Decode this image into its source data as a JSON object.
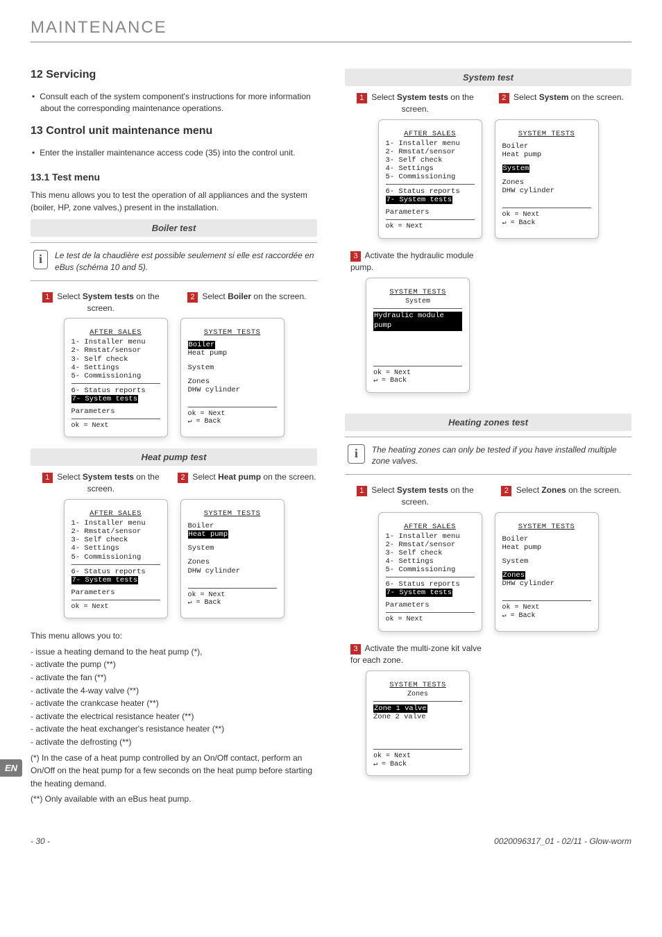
{
  "header": {
    "title": "MAINTENANCE"
  },
  "s12": {
    "heading": "12   Servicing",
    "bullet": "Consult each of the system component's instructions for more information about the corresponding maintenance operations."
  },
  "s13": {
    "heading": "13   Control unit maintenance menu",
    "bullet": "Enter the installer maintenance access code (35) into the control unit.",
    "sub": "13.1    Test menu",
    "intro": "This menu allows you to test the operation of all appliances and the system (boiler, HP, zone valves,) present in the installation."
  },
  "boiler": {
    "title": "Boiler test",
    "info": "Le test de la chaudière est possible seulement si elle est raccordée en eBus (schéma 10 and 5).",
    "step1": "Select System tests on the screen.",
    "step2": "Select Boiler on the screen."
  },
  "heatpump": {
    "title": "Heat pump test",
    "step1": "Select System tests on the screen.",
    "step2": "Select Heat pump on the screen.",
    "intro": "This menu allows you to:",
    "items": [
      "- issue a heating demand to the heat pump (*),",
      "- activate the pump (**)",
      "- activate the fan (**)",
      "- activate the 4-way valve (**)",
      "- activate the crankcase heater (**)",
      "- activate the electrical resistance heater (**)",
      "- activate the heat exchanger's resistance heater (**)",
      "- activate the defrosting (**)"
    ],
    "note1": "(*) In the case of a heat pump controlled by an On/Off contact, perform an On/Off on the heat pump for a few seconds on the heat pump before starting the heating demand.",
    "note2": "(**) Only available with an eBus heat pump."
  },
  "system": {
    "title": "System test",
    "step1": "Select System tests on the screen.",
    "step2": "Select System on the screen.",
    "step3": "Activate the hydraulic module pump."
  },
  "zones": {
    "title": "Heating zones test",
    "info": "The heating zones can only be tested if you have installed multiple zone valves.",
    "step1": "Select System tests on the screen.",
    "step2": "Select Zones on the screen.",
    "step3": "Activate the multi-zone kit valve for each zone."
  },
  "lcd": {
    "after_sales_title": "AFTER SALES",
    "sys_tests_title": "SYSTEM TESTS",
    "menu": [
      "1- Installer menu",
      "2- Rmstat/sensor",
      "3- Self check",
      "4- Settings",
      "5- Commissioning",
      "6- Status reports"
    ],
    "menu_hi": "7- System tests",
    "params": "Parameters",
    "ok_next": "ok  = Next",
    "back": "↵    = Back",
    "boiler": "Boiler",
    "heatpump": "Heat pump",
    "system_line": "System",
    "zones_line": "Zones",
    "dhw": "DHW cylinder",
    "hydraulic_sub": "System",
    "hydraulic_hi": "Hydraulic module pump",
    "zones_sub": "Zones",
    "zone1": "Zone 1 valve",
    "zone2": "Zone 2 valve"
  },
  "footer": {
    "lang": "EN",
    "page": "- 30 -",
    "doc": "0020096317_01 - 02/11 - Glow-worm"
  }
}
